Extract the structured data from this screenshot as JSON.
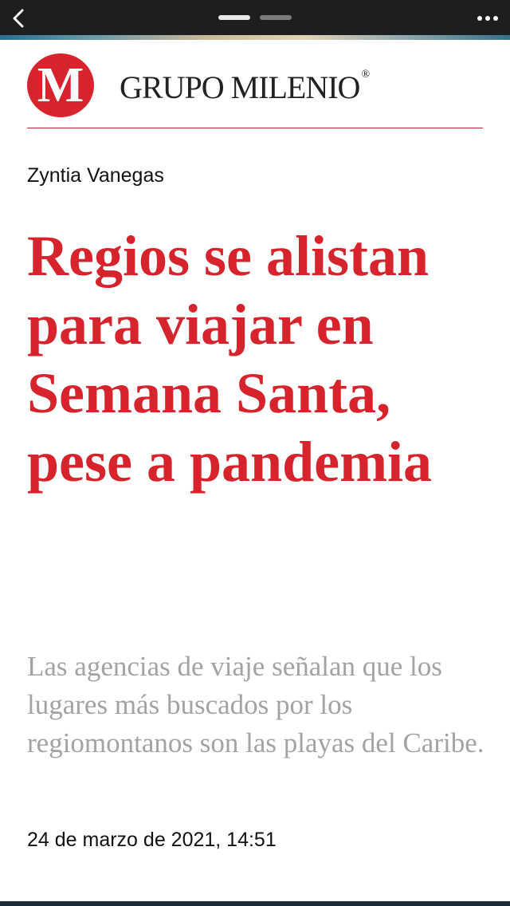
{
  "nav": {
    "back_icon": "chevron-left-icon",
    "more_icon": "more-horizontal-icon",
    "pages": 2,
    "current_page": 1
  },
  "brand": {
    "logo_letter": "M",
    "name": "GRUPO MILENIO",
    "registered_mark": "®",
    "color": "#d7232b"
  },
  "article": {
    "author": "Zyntia Vanegas",
    "headline": "Regios se alistan para viajar en Semana Santa, pese a pandemia",
    "summary": "Las agencias de viaje señalan que los lugares más buscados por los regiomontanos son las playas del Caribe.",
    "timestamp": "24 de marzo de 2021, 14:51"
  },
  "colors": {
    "headline": "#d7232b",
    "summary": "#a3a3a3",
    "topbar": "#1d1e20"
  }
}
